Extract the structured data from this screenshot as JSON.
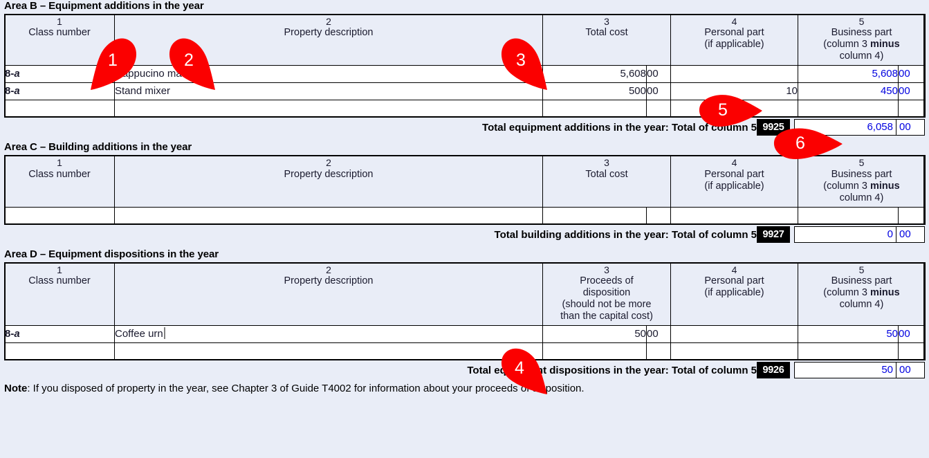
{
  "colors": {
    "page_background": "#e9edf7",
    "header_cell_background": "#e9edf7",
    "entered_value": "#0000e0",
    "marker": "#fb0000",
    "code_box": "#000000"
  },
  "areas": [
    {
      "key": "area_b",
      "title": "Area B – Equipment additions in the year",
      "headers": [
        {
          "num": "1",
          "lines": [
            "Class number"
          ]
        },
        {
          "num": "2",
          "lines": [
            "Property description"
          ]
        },
        {
          "num": "3",
          "lines": [
            "Total cost"
          ]
        },
        {
          "num": "4",
          "lines": [
            "Personal part",
            "(if applicable)"
          ]
        },
        {
          "num": "5",
          "lines": [
            "Business part",
            "(column 3 minus",
            "column 4)"
          ]
        }
      ],
      "rows": [
        {
          "class_number": "8-a",
          "description": "Cappucino machine",
          "total_cost": "5,608",
          "total_cost_cents": "00",
          "personal_part": "",
          "business_part": "5,608",
          "business_part_cents": "00"
        },
        {
          "class_number": "8-a",
          "description": "Stand mixer",
          "total_cost": "500",
          "total_cost_cents": "00",
          "personal_part": "10",
          "business_part": "450",
          "business_part_cents": "00"
        },
        {
          "class_number": "",
          "description": "",
          "total_cost": "",
          "total_cost_cents": "",
          "personal_part": "",
          "business_part": "",
          "business_part_cents": ""
        }
      ],
      "total": {
        "label": "Total equipment additions in the year: Total of column 5",
        "code": "9925",
        "dollars": "6,058",
        "cents": "00"
      }
    },
    {
      "key": "area_c",
      "title": "Area C – Building additions in the year",
      "headers": [
        {
          "num": "1",
          "lines": [
            "Class number"
          ]
        },
        {
          "num": "2",
          "lines": [
            "Property description"
          ]
        },
        {
          "num": "3",
          "lines": [
            "Total cost"
          ]
        },
        {
          "num": "4",
          "lines": [
            "Personal part",
            "(if applicable)"
          ]
        },
        {
          "num": "5",
          "lines": [
            "Business part",
            "(column 3 minus",
            "column 4)"
          ]
        }
      ],
      "rows": [
        {
          "class_number": "",
          "description": "",
          "total_cost": "",
          "total_cost_cents": "",
          "personal_part": "",
          "business_part": "",
          "business_part_cents": ""
        }
      ],
      "total": {
        "label": "Total building additions in the year: Total of column 5",
        "code": "9927",
        "dollars": "0",
        "cents": "00"
      }
    },
    {
      "key": "area_d",
      "title": "Area D – Equipment dispositions in the year",
      "headers": [
        {
          "num": "1",
          "lines": [
            "Class number"
          ]
        },
        {
          "num": "2",
          "lines": [
            "Property description"
          ]
        },
        {
          "num": "3",
          "lines": [
            "Proceeds of",
            "disposition",
            "(should not be more",
            "than the capital cost)"
          ]
        },
        {
          "num": "4",
          "lines": [
            "Personal part",
            "(if applicable)"
          ]
        },
        {
          "num": "5",
          "lines": [
            "Business part",
            "(column 3 minus",
            "column 4)"
          ]
        }
      ],
      "rows": [
        {
          "class_number": "8-a",
          "description": "Coffee urn",
          "has_caret": true,
          "total_cost": "50",
          "total_cost_cents": "00",
          "personal_part": "",
          "business_part": "50",
          "business_part_cents": "00"
        },
        {
          "class_number": "",
          "description": "",
          "total_cost": "",
          "total_cost_cents": "",
          "personal_part": "",
          "business_part": "",
          "business_part_cents": ""
        }
      ],
      "total": {
        "label": "Total equipment dispositions in the year: Total of column 5",
        "code": "9926",
        "dollars": "50",
        "cents": "00"
      }
    }
  ],
  "note": {
    "bold_prefix": "Note",
    "text": ": If you disposed of property in the year, see Chapter 3 of Guide T4002 for information about your proceeds of disposition."
  },
  "markers": [
    {
      "id": "1",
      "label": "1"
    },
    {
      "id": "2",
      "label": "2"
    },
    {
      "id": "3",
      "label": "3"
    },
    {
      "id": "4",
      "label": "4"
    },
    {
      "id": "5",
      "label": "5"
    },
    {
      "id": "6",
      "label": "6"
    }
  ]
}
